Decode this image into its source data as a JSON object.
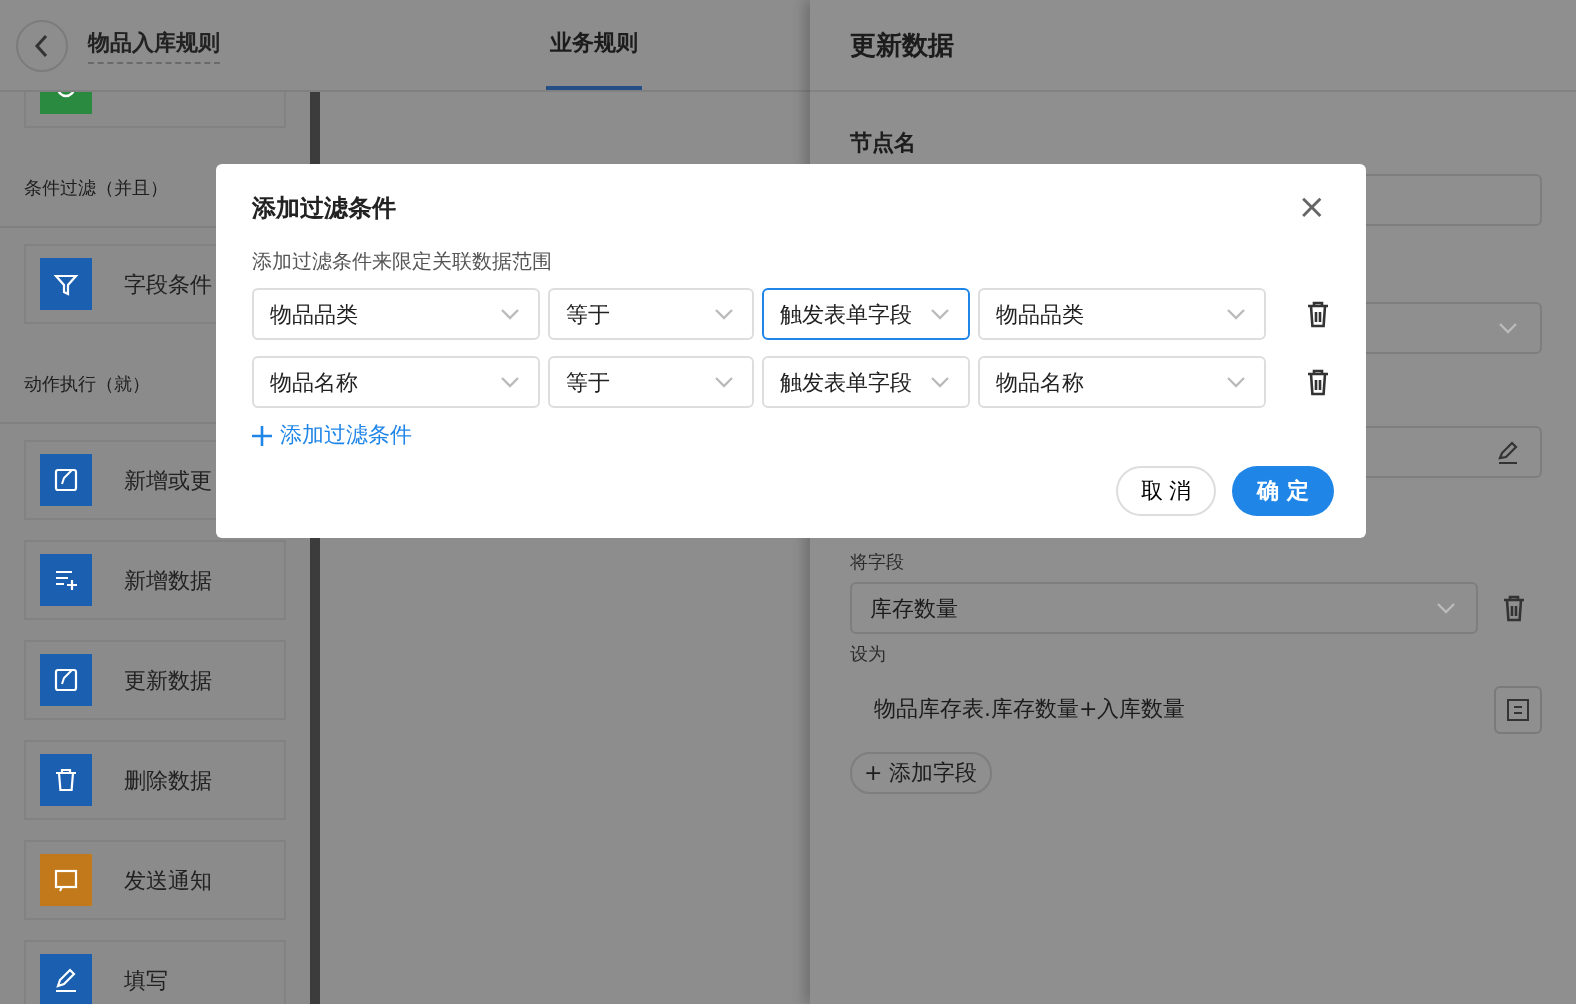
{
  "header": {
    "title": "物品入库规则"
  },
  "tabs": [
    {
      "label": "业务规则",
      "selected": true
    }
  ],
  "sidebar": {
    "sections": [
      {
        "items": [
          {
            "color": "#2a8a3f"
          }
        ]
      },
      {
        "label": "条件过滤（并且）",
        "items": [
          {
            "label": "字段条件",
            "color": "#1a5fb0"
          }
        ]
      },
      {
        "label": "动作执行（就）",
        "items": [
          {
            "label": "新增或更",
            "color": "#1a5fb0"
          },
          {
            "label": "新增数据",
            "color": "#1a5fb0"
          },
          {
            "label": "更新数据",
            "color": "#1a5fb0"
          },
          {
            "label": "删除数据",
            "color": "#1a5fb0"
          },
          {
            "label": "发送通知",
            "color": "#c2791c"
          },
          {
            "label": "填写",
            "color": "#1a5fb0"
          }
        ]
      }
    ]
  },
  "drawer": {
    "title": "更新数据",
    "node_name_label": "节点名",
    "target_field_label": "将字段",
    "target_field": "库存数量",
    "set_to_label": "设为",
    "set_to_value": "物品库存表.库存数量+入库数量",
    "add_field": "+ 添加字段"
  },
  "dialog": {
    "title": "添加过滤条件",
    "description": "添加过滤条件来限定关联数据范围",
    "close": "×",
    "rows": [
      {
        "field": "物品品类",
        "operator": "等于",
        "source": "触发表单字段",
        "value": "物品品类",
        "source_focused": true
      },
      {
        "field": "物品名称",
        "operator": "等于",
        "source": "触发表单字段",
        "value": "物品名称",
        "source_focused": false
      }
    ],
    "add_condition": "添加过滤条件",
    "cancel": "取 消",
    "confirm": "确 定"
  }
}
